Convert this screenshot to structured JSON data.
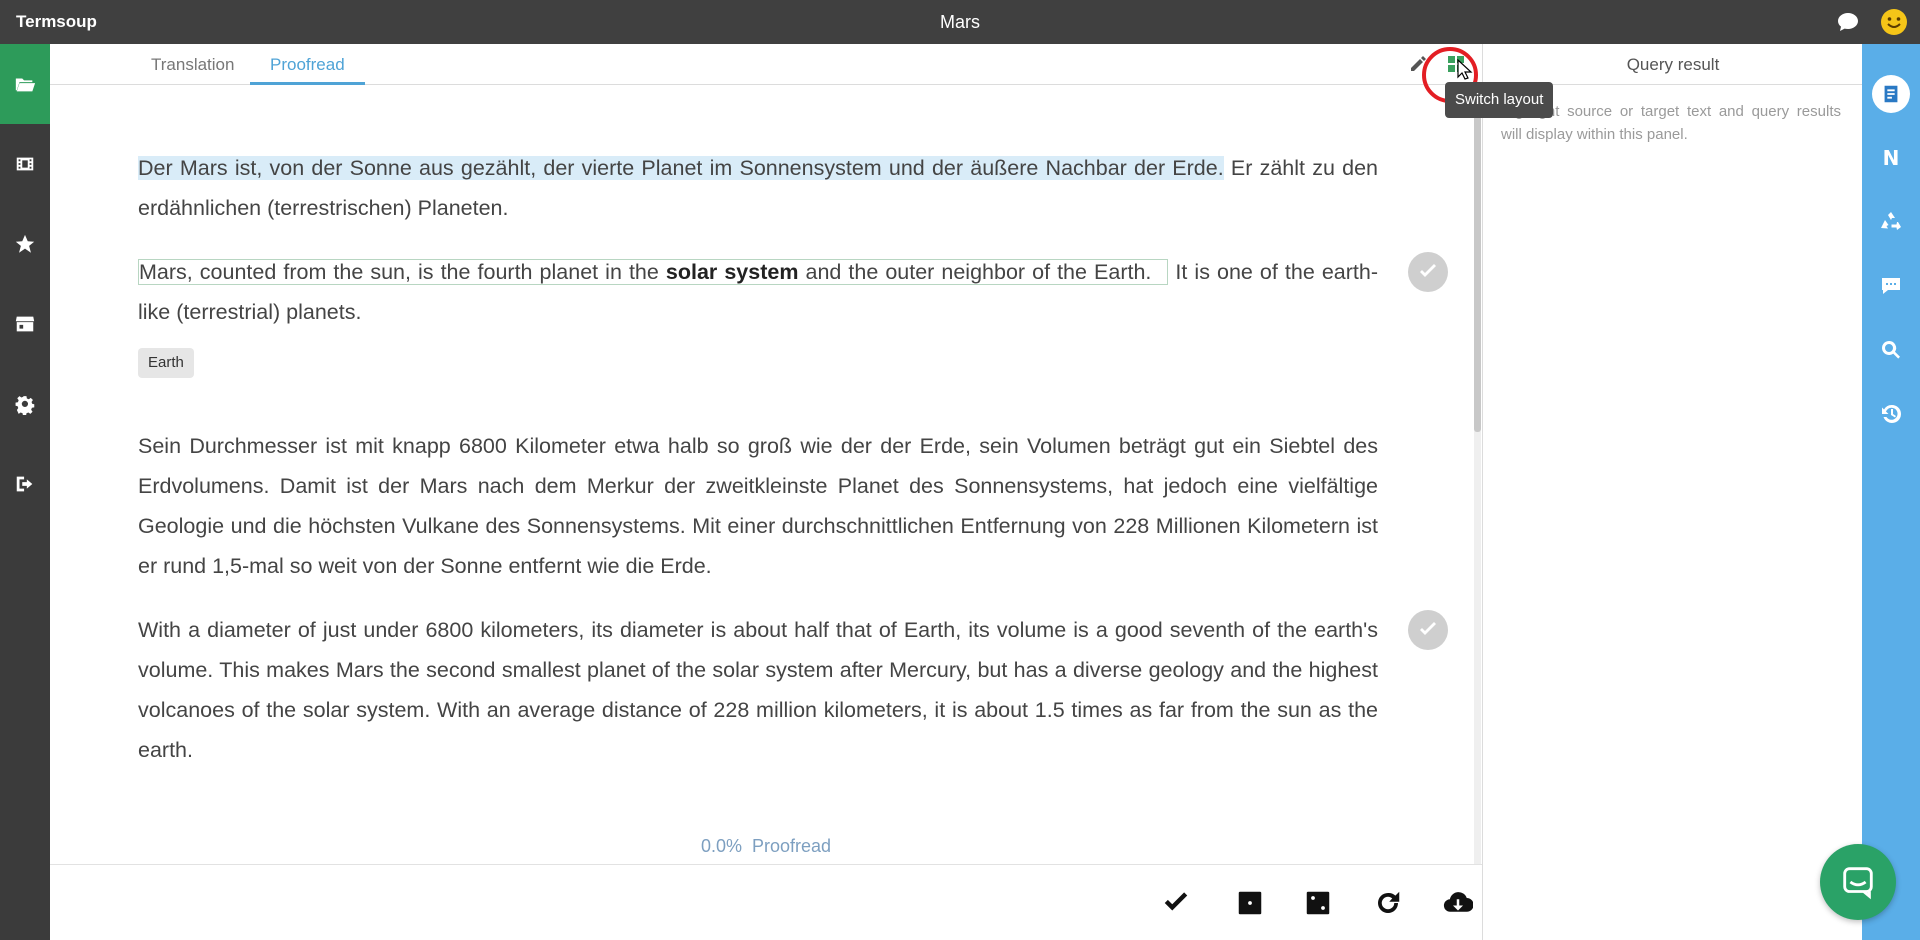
{
  "app": {
    "name": "Termsoup",
    "document_title": "Mars"
  },
  "tabs": [
    {
      "label": "Translation",
      "active": false
    },
    {
      "label": "Proofread",
      "active": true
    }
  ],
  "toolbar": {
    "tooltip": "Switch layout",
    "pencil_icon": "pencil-icon",
    "layout_icon": "switch-layout-icon"
  },
  "left_sidebar": {
    "items": [
      {
        "icon": "folder-open-icon",
        "active": true
      },
      {
        "icon": "film-icon",
        "active": false
      },
      {
        "icon": "star-icon",
        "active": false
      },
      {
        "icon": "store-icon",
        "active": false
      },
      {
        "icon": "gear-icon",
        "active": false
      },
      {
        "icon": "sign-out-icon",
        "active": false
      }
    ]
  },
  "segments": {
    "s1_source_highlight": "Der Mars ist, von der Sonne aus gezählt, der vierte Planet im Sonnensystem und der äußere Nachbar der Erde.",
    "s1_source_rest": " Er zählt zu den erdähnlichen (terrestrischen) Planeten.",
    "s1_target_a": "Mars, counted from the sun, is the fourth planet in the ",
    "s1_target_bold": "solar system",
    "s1_target_b": " and the outer neighbor of the Earth.",
    "s1_target_rest": " It is one of the earth-like (terrestrial) planets.",
    "term_tag": "Earth",
    "s2_source": "Sein Durchmesser ist mit knapp 6800 Kilometer etwa halb so groß wie der der Erde, sein Volumen beträgt gut ein Siebtel des Erdvolumens. Damit ist der Mars nach dem Merkur der zweitkleinste Planet des Sonnensystems, hat jedoch eine vielfältige Geologie und die höchsten Vulkane des Sonnensystems. Mit einer durchschnittlichen Entfernung von 228 Millionen Kilometern ist er rund 1,5-mal so weit von der Sonne entfernt wie die Erde.",
    "s2_target": "With a diameter of just under 6800 kilometers, its diameter is about half that of Earth, its volume is a good seventh of the earth's volume. This makes Mars the second smallest planet of the solar system after Mercury, but has a diverse geology and the highest volcanoes of the solar system. With an average distance of 228 million kilometers, it is about 1.5 times as far from the sun as the earth."
  },
  "progress": {
    "percent_text": "0.0%",
    "label": "Proofread",
    "value": 0.0
  },
  "bottom_actions": [
    "check-icon",
    "square-dot-icon",
    "dice-two-icon",
    "redo-icon",
    "cloud-download-icon"
  ],
  "query_panel": {
    "title": "Query result",
    "hint": "Highlight source or target text and query results will display within this panel."
  },
  "right_sidebar": {
    "items": [
      "notes-icon",
      "N",
      "recycle-icon",
      "comment-icon",
      "search-icon",
      "history-icon"
    ]
  },
  "colors": {
    "accent_green": "#2d9b5a",
    "accent_blue": "#4fa3d6",
    "right_sidebar": "#5aaee8",
    "highlight_ring": "#e31e24"
  }
}
